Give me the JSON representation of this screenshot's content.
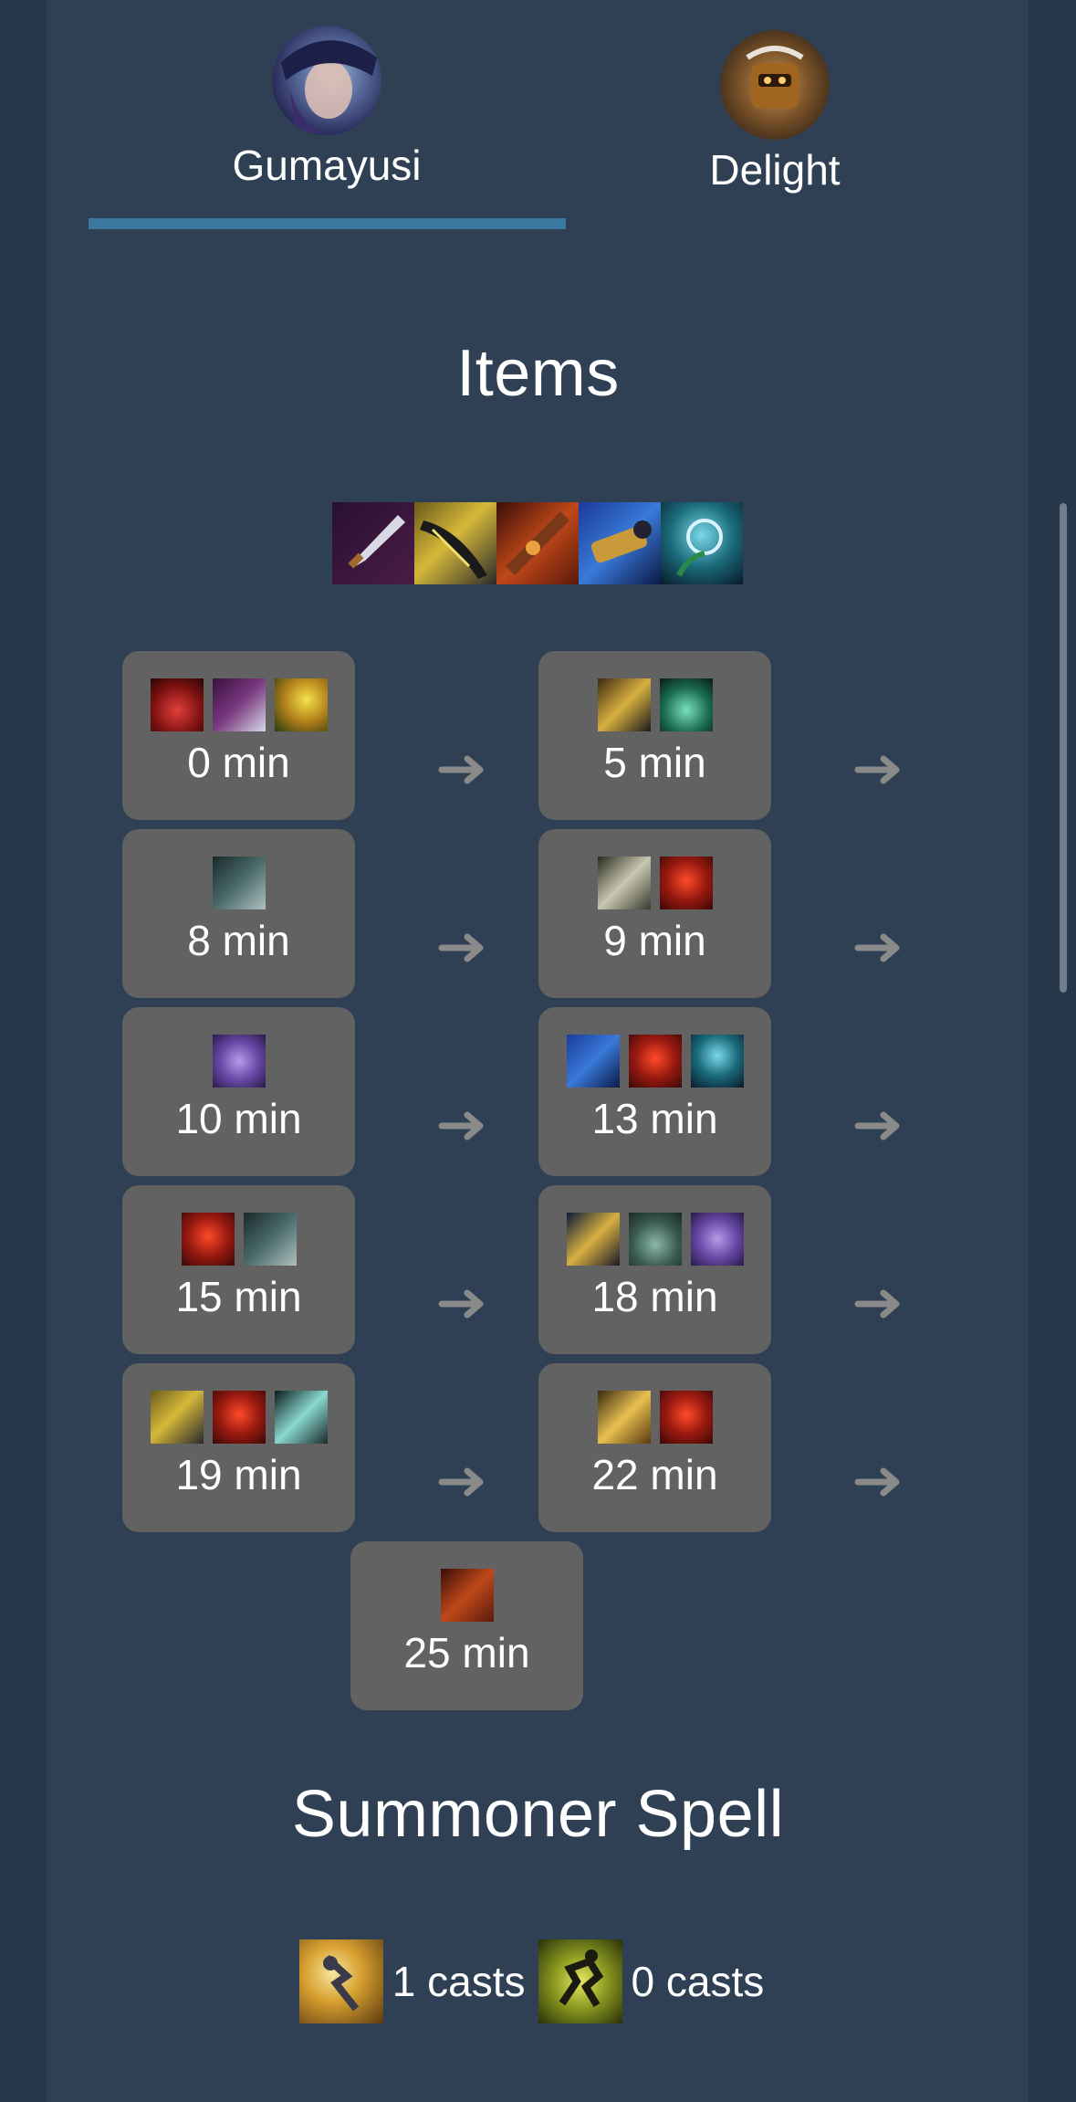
{
  "players": [
    {
      "name": "Gumayusi",
      "avatar_icon": "caitlyn-champion-icon",
      "selected": true
    },
    {
      "name": "Delight",
      "avatar_icon": "blitzcrank-champion-icon",
      "selected": false
    }
  ],
  "items_section": {
    "title": "Items",
    "final_build": [
      "infinity-edge-item-icon",
      "navori-quickblades-item-icon",
      "rapid-firecannon-item-icon",
      "collector-item-icon",
      "mercurial-scimitar-item-icon"
    ],
    "timeline": [
      {
        "time": "0 min",
        "items": [
          "health-potion-icon",
          "dagger-icon",
          "trinket-icon"
        ]
      },
      {
        "time": "5 min",
        "items": [
          "berserker-greaves-icon",
          "refillable-potion-icon"
        ]
      },
      {
        "time": "8 min",
        "items": [
          "pickaxe-icon"
        ]
      },
      {
        "time": "9 min",
        "items": [
          "long-sword-icon",
          "dark-seal-icon"
        ]
      },
      {
        "time": "10 min",
        "items": [
          "cloak-icon"
        ]
      },
      {
        "time": "13 min",
        "items": [
          "collector-item-icon",
          "dark-seal-icon",
          "mercurial-scimitar-item-icon"
        ]
      },
      {
        "time": "15 min",
        "items": [
          "dark-seal-icon",
          "pickaxe-icon"
        ]
      },
      {
        "time": "18 min",
        "items": [
          "serrated-dirk-icon",
          "elixir-icon",
          "cloak-icon"
        ]
      },
      {
        "time": "19 min",
        "items": [
          "navori-quickblades-item-icon",
          "dark-seal-icon",
          "glaive-icon"
        ]
      },
      {
        "time": "22 min",
        "items": [
          "bf-sword-icon",
          "dark-seal-icon"
        ]
      },
      {
        "time": "25 min",
        "items": [
          "rapid-firecannon-item-icon"
        ]
      }
    ]
  },
  "summoner_section": {
    "title": "Summoner Spell",
    "spells": [
      {
        "icon": "flash-spell-icon",
        "label": "1 casts"
      },
      {
        "icon": "ghost-spell-icon",
        "label": "0 casts"
      }
    ]
  },
  "colors": {
    "background": "#27374a",
    "panel": "#2f4054",
    "tile": "#626262",
    "tab_underline": "#3a78a0"
  }
}
